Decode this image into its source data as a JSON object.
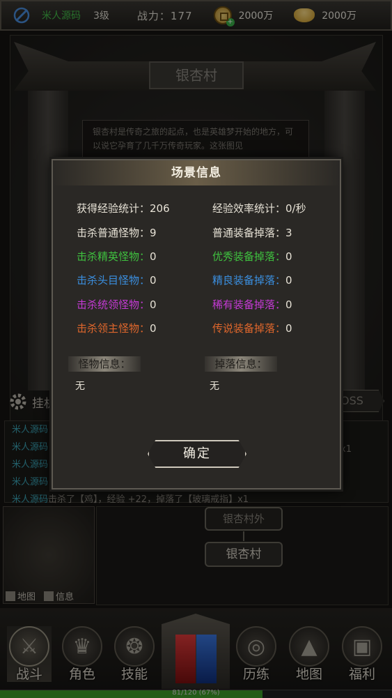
{
  "topbar": {
    "player_name": "米人源码",
    "level": "3级",
    "power": "战力：177",
    "coins": "2000万",
    "ingots": "2000万"
  },
  "scene": {
    "location_name": "银杏村",
    "description": "银杏村是传奇之旅的起点，也是英雄梦开始的地方，可以说它孕育了几千万传奇玩家。这张图见",
    "hang_label": "挂机",
    "boss_label": "OSS"
  },
  "log": {
    "rows": [
      {
        "who": "米人源码",
        "text": ""
      },
      {
        "who": "米人源码",
        "text": ""
      },
      {
        "who": "米人源码",
        "text": ""
      },
      {
        "who": "米人源码",
        "text": ""
      },
      {
        "who": "米人源码",
        "text": "击杀了【鸡】，经验 +22，掉落了【玻璃戒指】x1"
      }
    ],
    "x1": "x1"
  },
  "map": {
    "map_label": "地图",
    "info_label": "信息",
    "nodes": {
      "outer": "银杏村外",
      "current": "银杏村"
    }
  },
  "dialog": {
    "title": "场景信息",
    "left": [
      {
        "label": "获得经验统计：",
        "value": "206",
        "color": "#e7e2d6"
      },
      {
        "label": "击杀普通怪物：",
        "value": "9",
        "color": "#e7e2d6"
      },
      {
        "label": "击杀精英怪物：",
        "value": "0",
        "color": "#3fc13f"
      },
      {
        "label": "击杀头目怪物：",
        "value": "0",
        "color": "#3b8fe0"
      },
      {
        "label": "击杀统领怪物：",
        "value": "0",
        "color": "#c43ad4"
      },
      {
        "label": "击杀领主怪物：",
        "value": "0",
        "color": "#e0672c"
      }
    ],
    "right": [
      {
        "label": "经验效率统计：",
        "value": "0/秒",
        "color": "#e7e2d6"
      },
      {
        "label": "普通装备掉落：",
        "value": "3",
        "color": "#e7e2d6"
      },
      {
        "label": "优秀装备掉落：",
        "value": "0",
        "color": "#3fc13f"
      },
      {
        "label": "精良装备掉落：",
        "value": "0",
        "color": "#3b8fe0"
      },
      {
        "label": "稀有装备掉落：",
        "value": "0",
        "color": "#c43ad4"
      },
      {
        "label": "传说装备掉落：",
        "value": "0",
        "color": "#e0672c"
      }
    ],
    "monster_info_label": "怪物信息：",
    "monster_info_value": "无",
    "drop_info_label": "掉落信息：",
    "drop_info_value": "无",
    "confirm_label": "确定"
  },
  "nav": {
    "items": [
      {
        "label": "战斗",
        "icon": "swords-icon"
      },
      {
        "label": "角色",
        "icon": "helmet-icon"
      },
      {
        "label": "技能",
        "icon": "flame-icon"
      },
      {
        "label": "历练",
        "icon": "spiral-icon"
      },
      {
        "label": "地图",
        "icon": "mountain-icon"
      },
      {
        "label": "福利",
        "icon": "chest-icon"
      }
    ],
    "active": "战斗"
  },
  "exp": {
    "text": "81/120 (67%)",
    "progress": 0.67
  }
}
